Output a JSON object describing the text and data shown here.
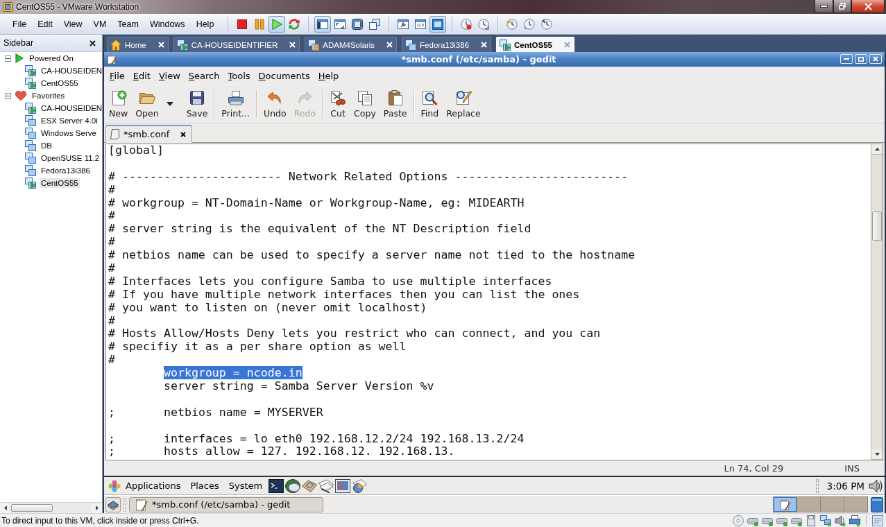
{
  "window": {
    "title": "CentOS55 - VMware Workstation"
  },
  "menu": [
    "File",
    "Edit",
    "View",
    "VM",
    "Team",
    "Windows",
    "Help"
  ],
  "vm_toolbar": [
    [
      {
        "pressed": false
      },
      {
        "pressed": false
      },
      {
        "pressed": true
      },
      {
        "pressed": false
      }
    ],
    [
      {
        "pressed": true
      },
      {
        "pressed": false
      },
      {
        "pressed": false
      },
      {
        "pressed": false
      }
    ],
    [
      {
        "pressed": false
      },
      {
        "pressed": false
      },
      {
        "pressed": true
      }
    ],
    [
      {
        "pressed": false
      },
      {
        "pressed": false
      }
    ],
    [
      {
        "pressed": false
      },
      {
        "pressed": false
      },
      {
        "pressed": false
      }
    ]
  ],
  "sidebar": {
    "title": "Sidebar",
    "items": [
      {
        "label": "Powered On",
        "kind": "powered",
        "expanded": true,
        "selected": false,
        "children": [
          {
            "label": "CA-HOUSEIDEN",
            "kind": "running",
            "selected": false
          },
          {
            "label": "CentOS55",
            "kind": "running",
            "selected": false
          }
        ]
      },
      {
        "label": "Favorites",
        "kind": "favorites",
        "expanded": true,
        "selected": false,
        "children": [
          {
            "label": "CA-HOUSEIDEN",
            "kind": "running",
            "selected": false
          },
          {
            "label": "ESX Server 4.0i",
            "kind": "stopped",
            "selected": false
          },
          {
            "label": "Windows Serve",
            "kind": "stopped",
            "selected": false
          },
          {
            "label": "DB",
            "kind": "stopped",
            "selected": false
          },
          {
            "label": "OpenSUSE 11.2",
            "kind": "stopped",
            "selected": false
          },
          {
            "label": "Fedora13i386",
            "kind": "stopped",
            "selected": false
          },
          {
            "label": "CentOS55",
            "kind": "running",
            "selected": true
          }
        ]
      }
    ]
  },
  "tabs": [
    {
      "label": "Home",
      "kind": "home",
      "selected": false
    },
    {
      "label": "CA-HOUSEIDENTIFIER",
      "kind": "running",
      "selected": false
    },
    {
      "label": "ADAM4Solaris",
      "kind": "paused",
      "selected": false
    },
    {
      "label": "Fedora13i386",
      "kind": "stopped",
      "selected": false
    },
    {
      "label": "CentOS55",
      "kind": "running",
      "selected": true
    }
  ],
  "editor_window": {
    "title": "*smb.conf (/etc/samba) - gedit",
    "menu": [
      "File",
      "Edit",
      "View",
      "Search",
      "Tools",
      "Documents",
      "Help"
    ],
    "toolbar": [
      [
        {
          "label": "New",
          "kind": "button",
          "disabled": false
        },
        {
          "label": "Open",
          "kind": "split",
          "disabled": false
        },
        {
          "label": "Save",
          "kind": "button",
          "disabled": false
        }
      ],
      [
        {
          "label": "Print...",
          "kind": "button",
          "disabled": false
        }
      ],
      [
        {
          "label": "Undo",
          "kind": "button",
          "disabled": false
        },
        {
          "label": "Redo",
          "kind": "button",
          "disabled": true
        }
      ],
      [
        {
          "label": "Cut",
          "kind": "button",
          "disabled": false
        },
        {
          "label": "Copy",
          "kind": "button",
          "disabled": false
        },
        {
          "label": "Paste",
          "kind": "button",
          "disabled": false
        }
      ],
      [
        {
          "label": "Find",
          "kind": "button",
          "disabled": false
        },
        {
          "label": "Replace",
          "kind": "button",
          "disabled": false
        }
      ]
    ],
    "document_tabs": [
      {
        "label": "*smb.conf",
        "selected": true
      }
    ],
    "lines": [
      {
        "kind": "text",
        "text": "[global]",
        "selected": false
      },
      {
        "kind": "blank"
      },
      {
        "kind": "text",
        "text": "# ----------------------- Network Related Options -------------------------",
        "selected": false
      },
      {
        "kind": "text",
        "text": "#",
        "selected": false
      },
      {
        "kind": "text",
        "text": "# workgroup = NT-Domain-Name or Workgroup-Name, eg: MIDEARTH",
        "selected": false
      },
      {
        "kind": "text",
        "text": "#",
        "selected": false
      },
      {
        "kind": "text",
        "text": "# server string is the equivalent of the NT Description field",
        "selected": false
      },
      {
        "kind": "text",
        "text": "#",
        "selected": false
      },
      {
        "kind": "text",
        "text": "# netbios name can be used to specify a server name not tied to the hostname",
        "selected": false
      },
      {
        "kind": "text",
        "text": "#",
        "selected": false
      },
      {
        "kind": "text",
        "text": "# Interfaces lets you configure Samba to use multiple interfaces",
        "selected": false
      },
      {
        "kind": "text",
        "text": "# If you have multiple network interfaces then you can list the ones",
        "selected": false
      },
      {
        "kind": "text",
        "text": "# you want to listen on (never omit localhost)",
        "selected": false
      },
      {
        "kind": "text",
        "text": "#",
        "selected": false
      },
      {
        "kind": "text",
        "text": "# Hosts Allow/Hosts Deny lets you restrict who can connect, and you can",
        "selected": false
      },
      {
        "kind": "text",
        "text": "# specifiy it as a per share option as well",
        "selected": false
      },
      {
        "kind": "text",
        "text": "#",
        "selected": false
      },
      {
        "kind": "text",
        "text": "\tworkgroup = ncode.in",
        "selected": true
      },
      {
        "kind": "text",
        "text": "\tserver string = Samba Server Version %v",
        "selected": false
      },
      {
        "kind": "blank"
      },
      {
        "kind": "text",
        "text": ";\tnetbios name = MYSERVER",
        "selected": false
      },
      {
        "kind": "blank"
      },
      {
        "kind": "text",
        "text": ";\tinterfaces = lo eth0 192.168.12.2/24 192.168.13.2/24",
        "selected": false
      },
      {
        "kind": "text",
        "text": ";\thosts allow = 127. 192.168.12. 192.168.13.",
        "selected": false
      }
    ],
    "status": {
      "position": "Ln 74, Col 29",
      "mode": "INS"
    }
  },
  "gnome_panel": {
    "menu": [
      "Applications",
      "Places",
      "System"
    ],
    "clock": "3:06 PM"
  },
  "taskbar": {
    "task": "*smb.conf (/etc/samba) - gedit",
    "workspaces": [
      {
        "selected": true
      },
      {
        "selected": false
      },
      {
        "selected": false
      },
      {
        "selected": false
      }
    ]
  },
  "status_bar": {
    "message": "To direct input to this VM, click inside or press Ctrl+G."
  }
}
